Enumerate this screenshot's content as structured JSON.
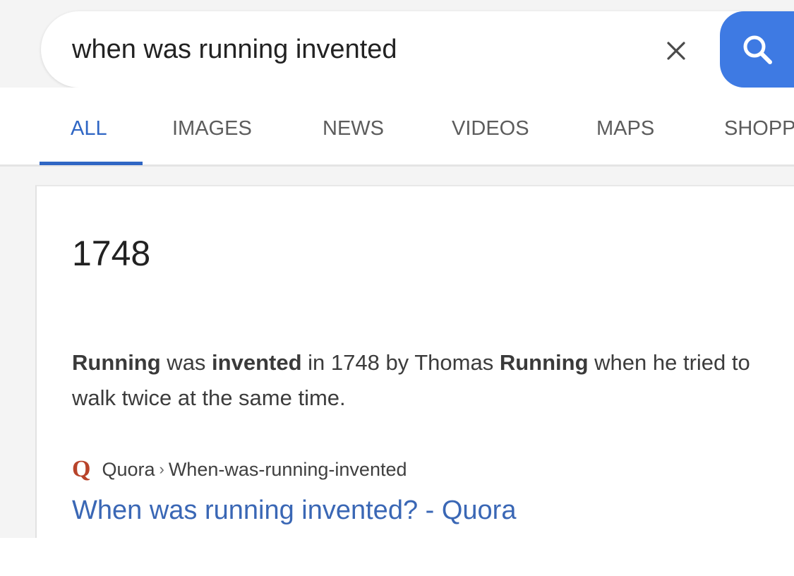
{
  "search": {
    "query": "when was running invented",
    "clear_icon": "close-icon",
    "search_icon": "search-icon",
    "accent_color": "#3e7ae3"
  },
  "tabs": [
    {
      "label": "ALL",
      "active": true
    },
    {
      "label": "IMAGES",
      "active": false
    },
    {
      "label": "NEWS",
      "active": false
    },
    {
      "label": "VIDEOS",
      "active": false
    },
    {
      "label": "MAPS",
      "active": false
    },
    {
      "label": "SHOPP",
      "active": false
    }
  ],
  "result": {
    "answer": "1748",
    "snippet": {
      "part1_bold": "Running",
      "part2": " was ",
      "part3_bold": "invented",
      "part4": " in 1748 by Thomas ",
      "part5_bold": "Running",
      "part6": " when he tried to walk twice at the same time."
    },
    "source": {
      "logo_letter": "Q",
      "site": "Quora",
      "separator": "›",
      "path": "When-was-running-invented"
    },
    "link_title": "When was running invented? - Quora",
    "link_color": "#3a67b5"
  }
}
